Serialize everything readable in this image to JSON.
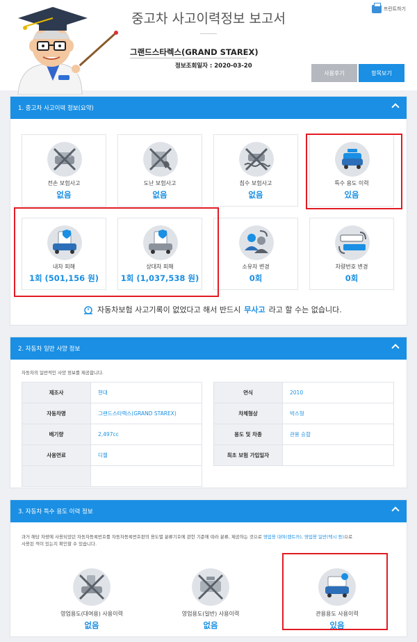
{
  "header": {
    "title": "중고차 사고이력정보 보고서",
    "car_name": "그랜드스타렉스(GRAND STAREX)",
    "lookup_label": "정보조회일자 :",
    "lookup_date": "2020-03-20",
    "print_label": "프린트하기",
    "review_button": "사용후기",
    "items_button": "항목보기"
  },
  "section1": {
    "heading": "1. 중고차 사고이력 정보(요약)",
    "cards": [
      {
        "label": "전손 보험사고",
        "value": "없음",
        "icon": "total-loss-crossed-icon"
      },
      {
        "label": "도난 보험사고",
        "value": "없음",
        "icon": "theft-crossed-icon"
      },
      {
        "label": "침수 보험사고",
        "value": "없음",
        "icon": "flood-crossed-icon"
      },
      {
        "label": "특수 용도 이력",
        "value": "있음",
        "icon": "special-use-car-icon"
      },
      {
        "label": "내차 피해",
        "value": "1회 (501,156 원)",
        "icon": "own-damage-car-icon"
      },
      {
        "label": "상대차 피해",
        "value": "1회 (1,037,538 원)",
        "icon": "other-damage-car-icon"
      },
      {
        "label": "소유자 변경",
        "value": "0회",
        "icon": "owner-change-icon"
      },
      {
        "label": "차량번호 변경",
        "value": "0회",
        "icon": "plate-change-icon"
      }
    ],
    "note_before": "자동차보험 사고기록이 없었다고 해서 반드시 ",
    "note_highlight": "무사고",
    "note_after": "라고 할 수는 없습니다."
  },
  "section2": {
    "heading": "2. 자동차 일반 사양 정보",
    "desc": "자동차의 일반적인 사양 정보를 제공합니다.",
    "left_rows": [
      {
        "k": "제조사",
        "v": "현대"
      },
      {
        "k": "자동차명",
        "v": "그랜드스타렉스(GRAND STAREX)"
      },
      {
        "k": "배기량",
        "v": "2,497cc"
      },
      {
        "k": "사용연료",
        "v": "디젤"
      },
      {
        "k": "",
        "v": ""
      }
    ],
    "right_rows": [
      {
        "k": "연식",
        "v": "2010"
      },
      {
        "k": "차체형상",
        "v": "박스형"
      },
      {
        "k": "용도 및 차종",
        "v": "관용 승합"
      },
      {
        "k": "최초 보험 가입일자",
        "v": ""
      }
    ]
  },
  "section3": {
    "heading": "3. 자동차 특수 용도 이력 정보",
    "desc_line1_a": "과거 해당 차량에 사용되었던 자동차등록번호를 자동차등록번호판의 용도별 분류기호에 관한 기준에 따라 분류, 제공하는 것으로 ",
    "desc_line1_hl": "영업용 대여(렌트카), 영업용 일반(택시 등)",
    "desc_line1_b": "으로",
    "desc_line2": "사용된 적이 있는지 확인할 수 있습니다.",
    "cards": [
      {
        "label": "영업용도(대여용) 사용이력",
        "value": "없음",
        "icon": "rental-crossed-icon"
      },
      {
        "label": "영업용도(일반) 사용이력",
        "value": "없음",
        "icon": "taxi-crossed-icon"
      },
      {
        "label": "관용용도 사용이력",
        "value": "있음",
        "icon": "government-car-icon"
      }
    ]
  },
  "colors": {
    "accent": "#1a8fe3",
    "highlight_box": "#e21a22",
    "icon_bg": "#dfe3e8"
  }
}
